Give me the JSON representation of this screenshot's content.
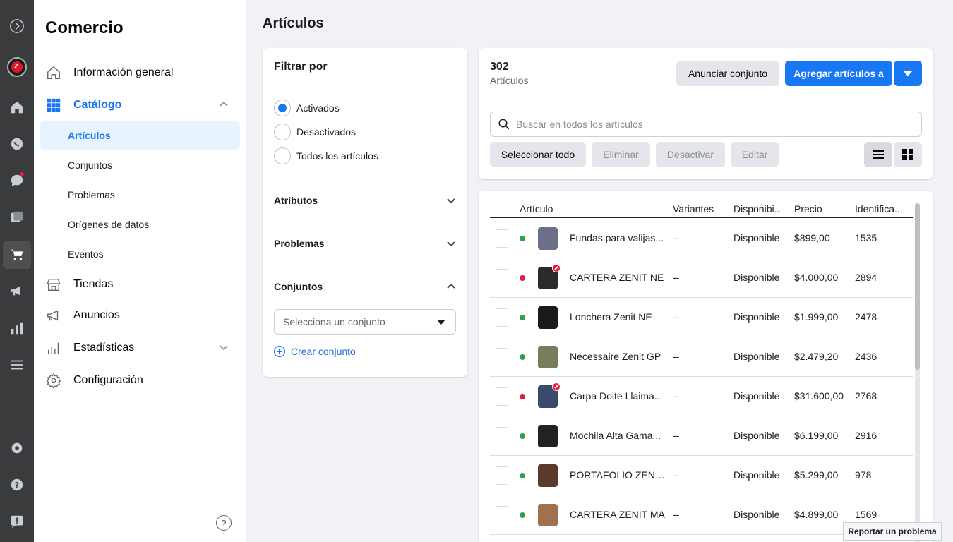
{
  "nav": {
    "title": "Comercio",
    "overview": "Información general",
    "catalog": "Catálogo",
    "sub": [
      "Artículos",
      "Conjuntos",
      "Problemas",
      "Orígenes de datos",
      "Eventos"
    ],
    "shops": "Tiendas",
    "ads": "Anuncios",
    "stats": "Estadísticas",
    "settings": "Configuración",
    "help": "?"
  },
  "page": {
    "title": "Artículos"
  },
  "filter": {
    "title": "Filtrar por",
    "options": [
      "Activados",
      "Desactivados",
      "Todos los artículos"
    ],
    "selected": "Activados",
    "attributes": "Atributos",
    "problems": "Problemas",
    "sets": "Conjuntos",
    "set_placeholder": "Selecciona un conjunto",
    "create_set": "Crear conjunto"
  },
  "summary": {
    "count": "302",
    "count_label": "Artículos",
    "announce": "Anunciar conjunto",
    "add": "Agregar artículos a",
    "search_placeholder": "Buscar en todos los artículos",
    "select_all": "Seleccionar todo",
    "delete": "Eliminar",
    "deactivate": "Desactivar",
    "edit": "Editar"
  },
  "table": {
    "headers": [
      "Artículo",
      "Variantes",
      "Disponibi...",
      "Precio",
      "Identifica..."
    ],
    "rows": [
      {
        "name": "Fundas para valijas...",
        "variants": "--",
        "availability": "Disponible",
        "price": "$899,00",
        "id": "1535",
        "status": "active",
        "warning": false
      },
      {
        "name": "CARTERA ZENIT NE",
        "variants": "--",
        "availability": "Disponible",
        "price": "$4.000,00",
        "id": "2894",
        "status": "inactive",
        "warning": true
      },
      {
        "name": "Lonchera Zenit NE",
        "variants": "--",
        "availability": "Disponible",
        "price": "$1.999,00",
        "id": "2478",
        "status": "active",
        "warning": false
      },
      {
        "name": "Necessaire Zenit GP",
        "variants": "--",
        "availability": "Disponible",
        "price": "$2.479,20",
        "id": "2436",
        "status": "active",
        "warning": false
      },
      {
        "name": "Carpa Doite Llaima...",
        "variants": "--",
        "availability": "Disponible",
        "price": "$31.600,00",
        "id": "2768",
        "status": "inactive",
        "warning": true
      },
      {
        "name": "Mochila Alta Gama...",
        "variants": "--",
        "availability": "Disponible",
        "price": "$6.199,00",
        "id": "2916",
        "status": "active",
        "warning": false
      },
      {
        "name": "PORTAFOLIO ZENI...",
        "variants": "--",
        "availability": "Disponible",
        "price": "$5.299,00",
        "id": "978",
        "status": "active",
        "warning": false
      },
      {
        "name": "CARTERA ZENIT MA",
        "variants": "--",
        "availability": "Disponible",
        "price": "$4.899,00",
        "id": "1569",
        "status": "active",
        "warning": false
      }
    ]
  },
  "report": "Reportar un problema",
  "colors": {
    "accent": "#1877f2",
    "active_dot": "#31a24c",
    "inactive_dot": "#e41e3f",
    "rail": "#3a3b3c"
  }
}
